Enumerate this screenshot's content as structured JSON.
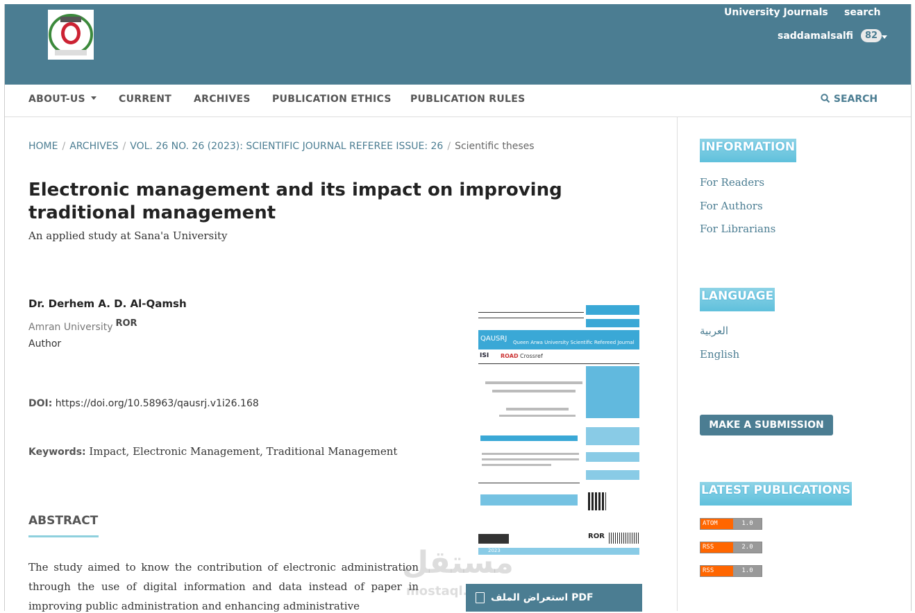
{
  "header": {
    "links": [
      "University Journals",
      "search"
    ],
    "username": "saddamalsalfi",
    "notification_count": "82"
  },
  "nav": {
    "items": [
      "ABOUT-US",
      "CURRENT",
      "ARCHIVES",
      "PUBLICATION ETHICS",
      "PUBLICATION RULES"
    ],
    "search_label": "SEARCH"
  },
  "breadcrumb": {
    "items": [
      "HOME",
      "ARCHIVES",
      "VOL. 26 NO. 26 (2023): SCIENTIFIC JOURNAL REFEREE ISSUE: 26"
    ],
    "current": "Scientific theses"
  },
  "article": {
    "title": "Electronic management and its impact on improving traditional management",
    "subtitle": "An applied study at Sana'a University",
    "author_name": "Dr. Derhem A. D. Al-Qamsh",
    "affiliation": "Amran University",
    "ror": "ROR",
    "role": "Author",
    "doi_label": "DOI:",
    "doi": "https://doi.org/10.58963/qausrj.v1i26.168",
    "keywords_label": "Keywords:",
    "keywords": "Impact, Electronic Management, Traditional Management",
    "abstract_heading": "ABSTRACT",
    "abstract_text": "The study aimed to know the contribution of electronic administration through the use of digital information and data instead of paper in improving public administration and enhancing administrative"
  },
  "cover": {
    "journal_code": "QAUSRJ",
    "journal_name": "Queen Arwa University Scientific Refereed Journal",
    "isi": "ISI",
    "road": "ROAD",
    "crossref": "Crossref",
    "year": "2023"
  },
  "pdf_button": {
    "label": "استعراض الملف PDF"
  },
  "watermark": {
    "arabic": "مستقل",
    "latin": "mostaql.com"
  },
  "sidebar": {
    "information_heading": "INFORMATION",
    "information_links": [
      "For Readers",
      "For Authors",
      "For Librarians"
    ],
    "language_heading": "LANGUAGE",
    "languages": [
      "العربية",
      "English"
    ],
    "submit_label": "MAKE A SUBMISSION",
    "latest_heading": "LATEST PUBLICATIONS",
    "feeds": [
      {
        "type": "ATOM",
        "version": "1.0"
      },
      {
        "type": "RSS",
        "version": "2.0"
      },
      {
        "type": "RSS",
        "version": "1.0"
      }
    ]
  },
  "colors": {
    "header": "#4b7d92",
    "accent": "#8ed0dd",
    "feed_orange": "#ff6600"
  }
}
